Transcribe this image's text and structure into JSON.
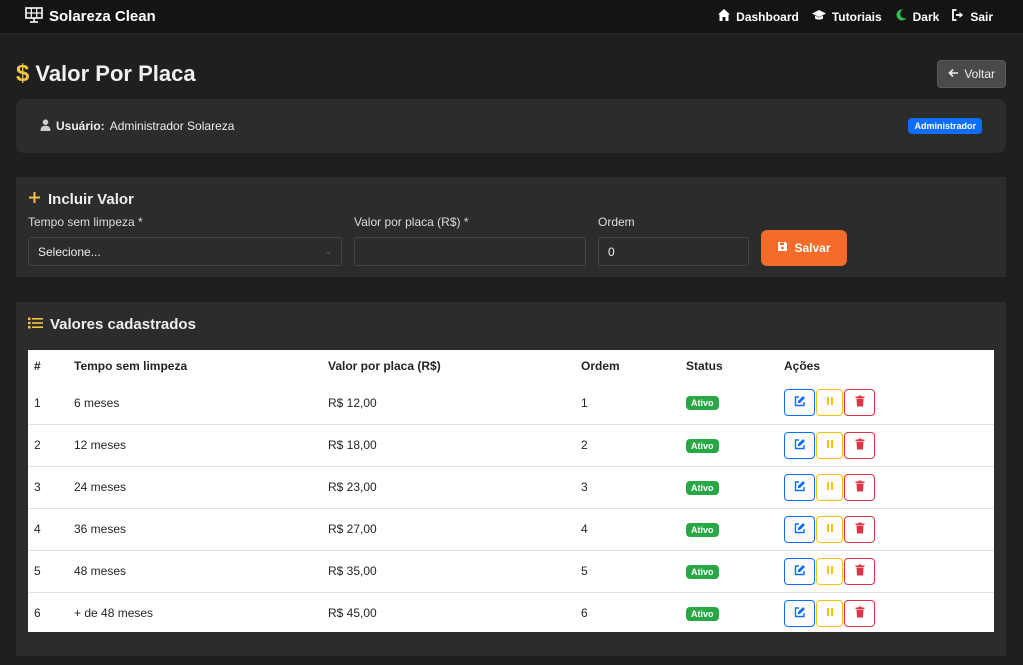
{
  "navbar": {
    "brand": "Solareza Clean",
    "links": [
      {
        "label": "Dashboard",
        "icon": "home-icon"
      },
      {
        "label": "Tutoriais",
        "icon": "graduation-cap-icon"
      },
      {
        "label": "Dark",
        "icon": "moon-icon"
      },
      {
        "label": "Sair",
        "icon": "logout-icon"
      }
    ]
  },
  "header": {
    "title": "Valor Por Placa",
    "back_label": "Voltar"
  },
  "user": {
    "label": "Usuário:",
    "name": "Administrador Solareza",
    "role_badge": "Administrador"
  },
  "add_form": {
    "title": "Incluir Valor",
    "tempo_label": "Tempo sem limpeza *",
    "tempo_value": "Selecione...",
    "valor_label": "Valor por placa (R$) *",
    "valor_value": "",
    "ordem_label": "Ordem",
    "ordem_value": "0",
    "save_label": "Salvar"
  },
  "list": {
    "title": "Valores cadastrados",
    "columns": [
      "#",
      "Tempo sem limpeza",
      "Valor por placa (R$)",
      "Ordem",
      "Status",
      "Ações"
    ],
    "rows": [
      {
        "id": "1",
        "tempo": "6 meses",
        "valor": "R$ 12,00",
        "ordem": "1",
        "status": "Ativo"
      },
      {
        "id": "2",
        "tempo": "12 meses",
        "valor": "R$ 18,00",
        "ordem": "2",
        "status": "Ativo"
      },
      {
        "id": "3",
        "tempo": "24 meses",
        "valor": "R$ 23,00",
        "ordem": "3",
        "status": "Ativo"
      },
      {
        "id": "4",
        "tempo": "36 meses",
        "valor": "R$ 27,00",
        "ordem": "4",
        "status": "Ativo"
      },
      {
        "id": "5",
        "tempo": "48 meses",
        "valor": "R$ 35,00",
        "ordem": "5",
        "status": "Ativo"
      },
      {
        "id": "6",
        "tempo": "+ de 48 meses",
        "valor": "R$ 45,00",
        "ordem": "6",
        "status": "Ativo"
      }
    ]
  },
  "colors": {
    "accent_orange": "#f46b2a",
    "dollar_yellow": "#f5c242",
    "status_green": "#28a745",
    "admin_blue": "#0d6efd"
  }
}
